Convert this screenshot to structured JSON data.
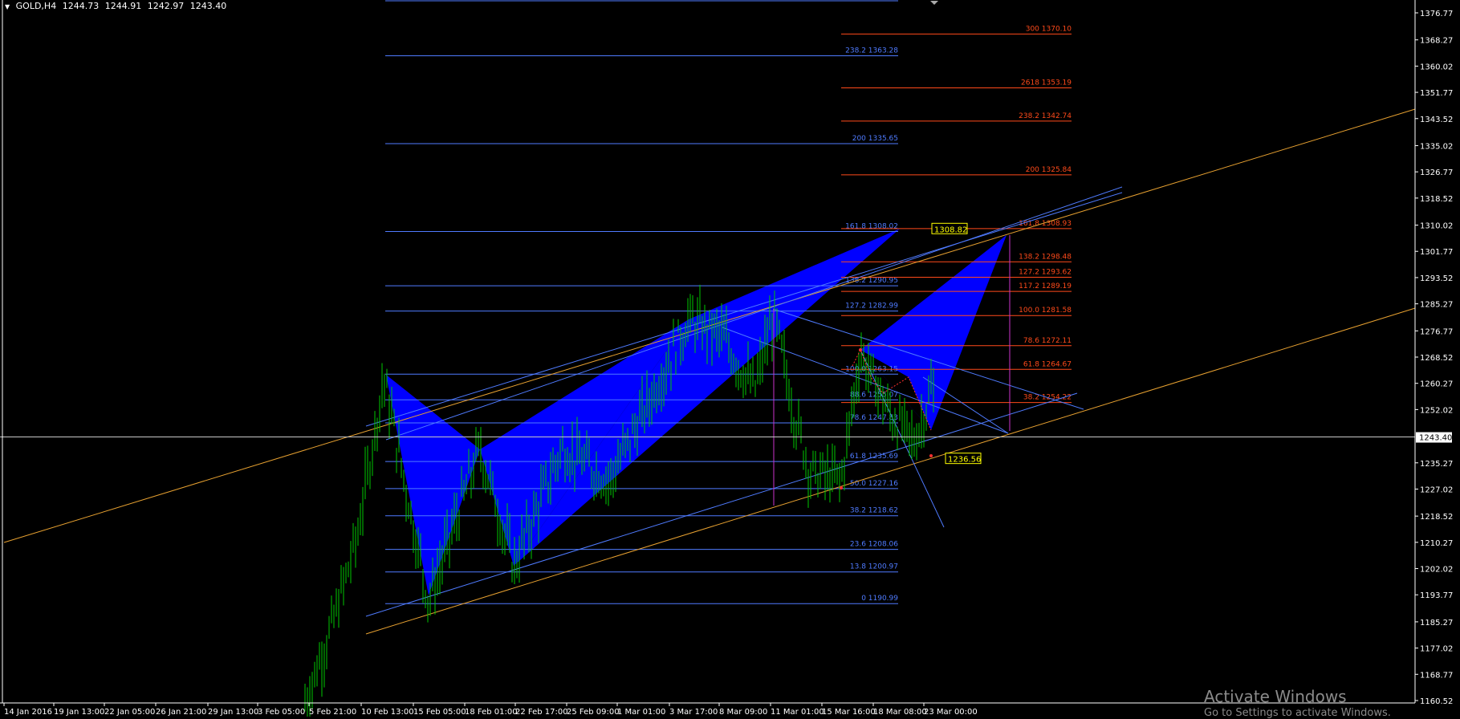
{
  "header": {
    "symbol": "GOLD,H4",
    "values": [
      "1244.73",
      "1244.91",
      "1242.97",
      "1243.40"
    ]
  },
  "price_axis": {
    "ticks": [
      "1376.77",
      "1368.27",
      "1360.02",
      "1351.77",
      "1343.52",
      "1335.02",
      "1326.77",
      "1318.52",
      "1310.02",
      "1301.77",
      "1293.52",
      "1285.27",
      "1276.77",
      "1268.52",
      "1260.27",
      "1252.02",
      "1235.27",
      "1227.02",
      "1218.52",
      "1210.27",
      "1202.02",
      "1193.77",
      "1185.27",
      "1177.02",
      "1168.77",
      "1160.52"
    ],
    "current_price": "1243.40"
  },
  "time_axis": {
    "labels": [
      "14 Jan 2016",
      "19 Jan 13:00",
      "22 Jan 05:00",
      "26 Jan 21:00",
      "29 Jan 13:00",
      "3 Feb 05:00",
      "5 Feb 21:00",
      "10 Feb 13:00",
      "15 Feb 05:00",
      "18 Feb 01:00",
      "22 Feb 17:00",
      "25 Feb 09:00",
      "1 Mar 01:00",
      "3 Mar 17:00",
      "8 Mar 09:00",
      "11 Mar 01:00",
      "15 Mar 16:00",
      "18 Mar 08:00",
      "23 Mar 00:00"
    ]
  },
  "fib_blue": [
    {
      "label": "238.2  1363.28",
      "price": 1363.28
    },
    {
      "label": "200  1335.65",
      "price": 1335.65
    },
    {
      "label": "161.8  1308.02",
      "price": 1308.02
    },
    {
      "label": "138.2  1290.95",
      "price": 1290.95
    },
    {
      "label": "127.2  1282.99",
      "price": 1282.99
    },
    {
      "label": "100.0  1263.15",
      "price": 1263.15
    },
    {
      "label": "88.6  1255.07",
      "price": 1255.07
    },
    {
      "label": "78.6  1247.83",
      "price": 1247.83
    },
    {
      "label": "61.8  1235.69",
      "price": 1235.69
    },
    {
      "label": "50.0  1227.16",
      "price": 1227.16
    },
    {
      "label": "38.2  1218.62",
      "price": 1218.62
    },
    {
      "label": "23.6  1208.06",
      "price": 1208.06
    },
    {
      "label": "13.8  1200.97",
      "price": 1200.97
    },
    {
      "label": "0  1190.99",
      "price": 1190.99
    }
  ],
  "fib_red": [
    {
      "label": "300  1370.10",
      "price": 1370.1
    },
    {
      "label": "2618  1353.19",
      "price": 1353.19
    },
    {
      "label": "238.2  1342.74",
      "price": 1342.74
    },
    {
      "label": "200  1325.84",
      "price": 1325.84
    },
    {
      "label": "161.8  1308.93",
      "price": 1308.93
    },
    {
      "label": "138.2  1298.48",
      "price": 1298.48
    },
    {
      "label": "127.2  1293.62",
      "price": 1293.62
    },
    {
      "label": "117.2  1289.19",
      "price": 1289.19
    },
    {
      "label": "100.0    1281.58",
      "price": 1281.58
    },
    {
      "label": "78.6  1272.11",
      "price": 1272.11
    },
    {
      "label": "61.8  1264.67",
      "price": 1264.67
    },
    {
      "label": "38.2  1254.22",
      "price": 1254.22
    }
  ],
  "price_tags": [
    {
      "text": "1308.82",
      "price": 1308.82
    },
    {
      "text": "1236.56",
      "price": 1236.56
    }
  ],
  "watermark": {
    "title": "Activate Windows",
    "subtitle": "Go to Settings to activate Windows."
  },
  "colors": {
    "background": "#000000",
    "axis": "#ffffff",
    "bull_candle": "#00c800",
    "pattern_fill": "#0000ff",
    "fib_blue": "#4f7bff",
    "fib_red": "#ff4a1a",
    "trend_orange": "#e6a030",
    "magenta": "#cc33cc",
    "current_price_line": "#c8c8c8"
  }
}
